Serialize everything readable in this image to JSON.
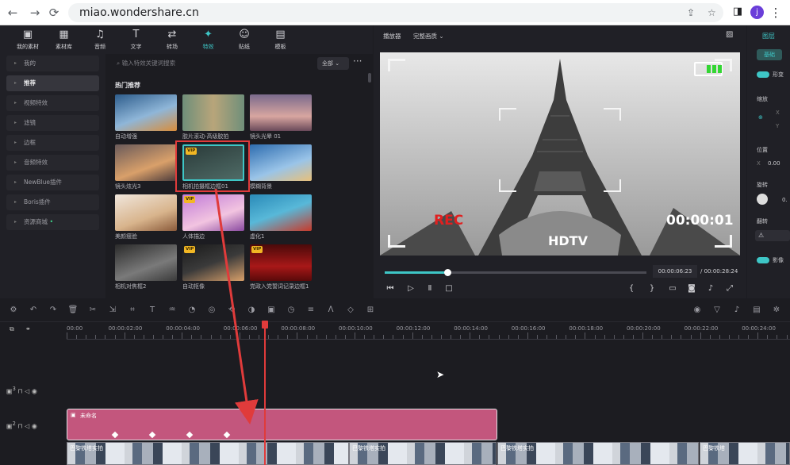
{
  "browser": {
    "url": "miao.wondershare.cn",
    "avatar": "j",
    "back": "←",
    "forward": "→",
    "reload": "⟳",
    "share": "⇪",
    "star": "☆",
    "panel": "◨",
    "menu": "⋮"
  },
  "toolbar": {
    "items": [
      {
        "label": "我的素材",
        "icon": "media-icon",
        "glyph": "▣"
      },
      {
        "label": "素材库",
        "icon": "stock-icon",
        "glyph": "▦"
      },
      {
        "label": "音频",
        "icon": "music-icon",
        "glyph": "♫"
      },
      {
        "label": "文字",
        "icon": "text-icon",
        "glyph": "T"
      },
      {
        "label": "转场",
        "icon": "transition-icon",
        "glyph": "⇄"
      },
      {
        "label": "特效",
        "icon": "effects-icon",
        "glyph": "✦"
      },
      {
        "label": "贴纸",
        "icon": "sticker-icon",
        "glyph": "☺"
      },
      {
        "label": "模板",
        "icon": "template-icon",
        "glyph": "▤"
      }
    ],
    "active_index": 5
  },
  "sidebar": {
    "items": [
      "我的",
      "推荐",
      "视频特效",
      "滤镜",
      "边框",
      "音频特效",
      "NewBlue插件",
      "Boris插件",
      "资源商城"
    ],
    "active_index": 1,
    "collapse": "‹"
  },
  "effects": {
    "search_placeholder": "输入特效关键词搜索",
    "filter": "全部",
    "more": "···",
    "section": "热门推荐",
    "items": [
      {
        "label": "自动增强",
        "vip": false
      },
      {
        "label": "胶片滚动-高级胶拍",
        "vip": false
      },
      {
        "label": "镜头光晕 01",
        "vip": false
      },
      {
        "label": "镜头炫光3",
        "vip": false
      },
      {
        "label": "相机拍摄框边框01",
        "vip": true
      },
      {
        "label": "模糊背景",
        "vip": false
      },
      {
        "label": "美颜瘦脸",
        "vip": false
      },
      {
        "label": "人体描边",
        "vip": true
      },
      {
        "label": "虚化1",
        "vip": false
      },
      {
        "label": "相机对焦框2",
        "vip": false
      },
      {
        "label": "自动抠像",
        "vip": true
      },
      {
        "label": "党政入党誓词记录边框1",
        "vip": true
      }
    ],
    "vip_badge": "VIP"
  },
  "player": {
    "label": "播放器",
    "quality": "完整画质",
    "rec": "REC",
    "timecode": "00:00:01",
    "hdtv": "HDTV",
    "current_time": "00:00:06:23",
    "total_time": "/ 00:00:28:24",
    "progress": 0.24,
    "battery_cells": 3
  },
  "properties": {
    "tab": "图层",
    "basic": "基础",
    "transform": "形变",
    "scale": "缩放",
    "x": "X",
    "y": "Y",
    "position": "位置",
    "pos_x_label": "X",
    "pos_x": "0.00",
    "rotate": "旋转",
    "rotate_val": "0.",
    "flip": "翻转",
    "flip_icon": "⚠",
    "shadow": "影像"
  },
  "timeline": {
    "ruler": [
      "00:00",
      "00:00:02:00",
      "00:00:04:00",
      "00:00:06:00",
      "00:00:08:00",
      "00:00:10:00",
      "00:00:12:00",
      "00:00:14:00",
      "00:00:16:00",
      "00:00:18:00",
      "00:00:20:00",
      "00:00:22:00",
      "00:00:24:00"
    ],
    "tracks": [
      {
        "num": "3"
      },
      {
        "num": "2"
      }
    ],
    "effect_clip": "未命名",
    "video_clips": [
      "巴黎铁塔实拍",
      "巴黎铁塔实拍",
      "巴黎铁塔实拍",
      "巴黎铁塔"
    ],
    "keyframe_count": 4,
    "playhead_time": "00:00:06:23"
  },
  "colors": {
    "accent": "#3ec6c6",
    "clip": "#c3567d",
    "highlight": "#e03b3b",
    "rec": "#e02020",
    "battery": "#33d633"
  }
}
